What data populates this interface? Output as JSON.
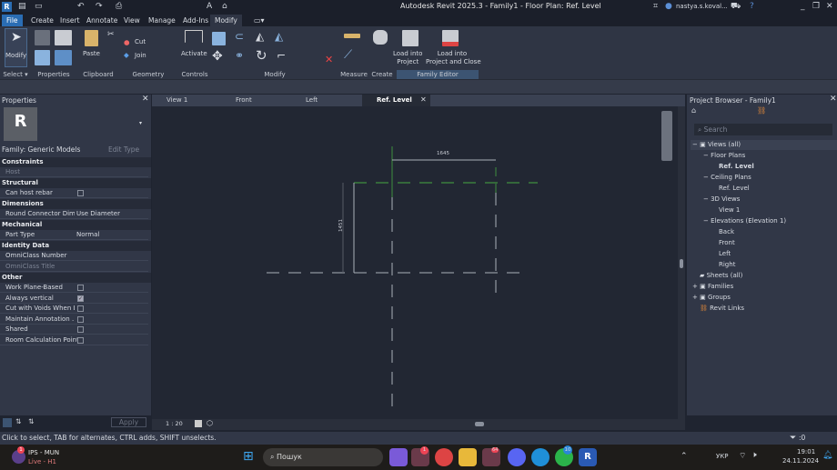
{
  "app": {
    "title": "Autodesk Revit 2025.3 - Family1 - Floor Plan: Ref. Level",
    "user": "nastya.s.koval..."
  },
  "ribbon_tabs": [
    "File",
    "Create",
    "Insert",
    "Annotate",
    "View",
    "Manage",
    "Add-Ins",
    "Modify"
  ],
  "ribbon": {
    "modify": "Modify",
    "paste": "Paste",
    "cut": "Cut",
    "join": "Join",
    "activate": "Activate",
    "load_project": "Load into\nProject",
    "load_project_l1": "Load into",
    "load_project_l2": "Project",
    "load_close_l1": "Load into",
    "load_close_l2": "Project and Close",
    "panels": {
      "select": "Select ▾",
      "properties": "Properties",
      "clipboard": "Clipboard",
      "geometry": "Geometry",
      "controls": "Controls",
      "modify": "Modify",
      "measure": "Measure",
      "create": "Create",
      "family_editor": "Family Editor"
    }
  },
  "properties": {
    "title": "Properties",
    "type_selector": "Family: Generic Models",
    "edit_type": "Edit Type",
    "apply": "Apply",
    "sections": {
      "constraints": "Constraints",
      "structural": "Structural",
      "dimensions": "Dimensions",
      "mechanical": "Mechanical",
      "identity": "Identity Data",
      "other": "Other"
    },
    "rows": {
      "host": "Host",
      "can_host_rebar": "Can host rebar",
      "round_connector": "Round Connector Dim...",
      "round_connector_val": "Use Diameter",
      "part_type": "Part Type",
      "part_type_val": "Normal",
      "omni_number": "OmniClass Number",
      "omni_title": "OmniClass Title",
      "work_plane": "Work Plane-Based",
      "always_vertical": "Always vertical",
      "cut_voids": "Cut with Voids When L...",
      "maintain_annot": "Maintain Annotation ...",
      "shared": "Shared",
      "room_calc": "Room Calculation Point"
    },
    "checks": {
      "can_host_rebar": false,
      "work_plane": false,
      "always_vertical": true,
      "cut_voids": false,
      "maintain_annot": false,
      "shared": false,
      "room_calc": false
    }
  },
  "doc_tabs": [
    "View 1",
    "Front",
    "Left",
    "Ref. Level"
  ],
  "canvas": {
    "dim_horizontal": "1645",
    "dim_vertical": "1451",
    "scale": "1 : 20"
  },
  "browser": {
    "title": "Project Browser - Family1",
    "search_placeholder": "Search",
    "tree": {
      "views": "Views (all)",
      "floor_plans": "Floor Plans",
      "fp_ref": "Ref. Level",
      "ceiling_plans": "Ceiling Plans",
      "cp_ref": "Ref. Level",
      "views_3d": "3D Views",
      "view1": "View 1",
      "elevations": "Elevations (Elevation 1)",
      "back": "Back",
      "front": "Front",
      "left": "Left",
      "right": "Right",
      "sheets": "Sheets (all)",
      "families": "Families",
      "groups": "Groups",
      "links": "Revit Links"
    }
  },
  "status": {
    "text": "Click to select, TAB for alternates, CTRL adds, SHIFT unselects.",
    "filter_count": ":0"
  },
  "taskbar": {
    "app_name": "IPS - MUN",
    "app_sub": "Live - H1",
    "search": "Пошук",
    "lang": "УКР",
    "time": "19:01",
    "date": "24.11.2024",
    "teams_badge": "1",
    "telegram_badge": "64",
    "whatsapp_badge": "10",
    "left_badge": "1"
  },
  "colors": {
    "accent": "#2a6db4",
    "ref_plane": "#3f8f3f",
    "canvas_bg": "#222733"
  }
}
